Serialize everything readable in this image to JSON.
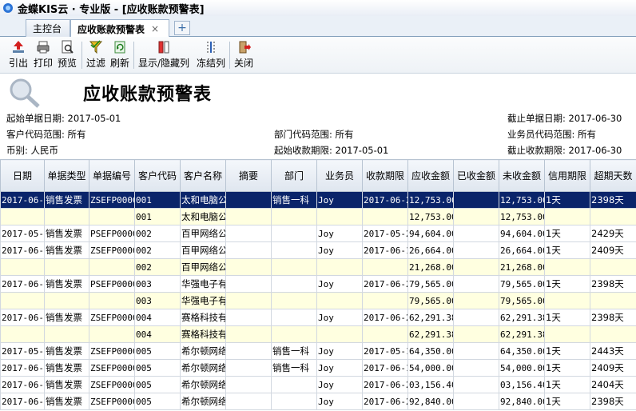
{
  "window": {
    "title": "金蝶KIS云 · 专业版 - [应收账款预警表]"
  },
  "tabs": [
    {
      "label": "主控台"
    },
    {
      "label": "应收账款预警表",
      "close": "×"
    }
  ],
  "tab_add": "+",
  "toolbar": {
    "export": "引出",
    "print": "打印",
    "preview": "预览",
    "filter": "过滤",
    "refresh": "刷新",
    "show_hide": "显示/隐藏列",
    "freeze": "冻结列",
    "close": "关闭"
  },
  "report": {
    "title": "应收账款预警表",
    "start_date": "起始单据日期: 2017-05-01",
    "end_date": "截止单据日期: 2017-06-30",
    "customer_range": "客户代码范围: 所有",
    "dept_range": "部门代码范围: 所有",
    "staff_range": "业务员代码范围: 所有",
    "currency": "币别: 人民币",
    "start_due": "起始收款期限: 2017-05-01",
    "end_due": "截止收款期限: 2017-06-30"
  },
  "columns": [
    "日期",
    "单据类型",
    "单据编号",
    "客户代码",
    "客户名称",
    "摘要",
    "部门",
    "业务员",
    "收款期限",
    "应收金额",
    "已收金额",
    "未收金额",
    "信用期限",
    "超期天数"
  ],
  "rows": [
    {
      "kind": "sel",
      "cells": [
        "2017-06-2",
        "销售发票（",
        "ZSEFP0000",
        "001",
        "太和电脑公",
        "",
        "销售一科",
        "Joy",
        "2017-06-2",
        "12,753.00",
        "",
        "12,753.00",
        "1天",
        "2398天"
      ]
    },
    {
      "kind": "sub",
      "cells": [
        "",
        "",
        "",
        "001",
        "太和电脑公",
        "",
        "",
        "",
        "",
        "12,753.00",
        "",
        "12,753.00",
        "",
        ""
      ]
    },
    {
      "kind": "row",
      "cells": [
        "2017-05-2",
        "销售发票（",
        "PSEFP0000",
        "002",
        "百甲网络公",
        "",
        "",
        "Joy",
        "2017-05-2",
        "94,604.00",
        "",
        "94,604.00",
        "1天",
        "2429天"
      ]
    },
    {
      "kind": "row",
      "cells": [
        "2017-06-1",
        "销售发票（",
        "ZSEFP0000",
        "002",
        "百甲网络公",
        "",
        "",
        "Joy",
        "2017-06-1",
        "26,664.00",
        "",
        "26,664.00",
        "1天",
        "2409天"
      ]
    },
    {
      "kind": "sub",
      "cells": [
        "",
        "",
        "",
        "002",
        "百甲网络公",
        "",
        "",
        "",
        "",
        "21,268.00",
        "",
        "21,268.00",
        "",
        ""
      ]
    },
    {
      "kind": "row",
      "cells": [
        "2017-06-2",
        "销售发票（",
        "PSEFP0000",
        "003",
        "华强电子有",
        "",
        "",
        "Joy",
        "2017-06-2",
        "79,565.00",
        "",
        "79,565.00",
        "1天",
        "2398天"
      ]
    },
    {
      "kind": "sub",
      "cells": [
        "",
        "",
        "",
        "003",
        "华强电子有",
        "",
        "",
        "",
        "",
        "79,565.00",
        "",
        "79,565.00",
        "",
        ""
      ]
    },
    {
      "kind": "row",
      "cells": [
        "2017-06-2",
        "销售发票（",
        "ZSEFP0000",
        "004",
        "赛格科技有",
        "",
        "",
        "Joy",
        "2017-06-2",
        "62,291.38",
        "",
        "62,291.38",
        "1天",
        "2398天"
      ]
    },
    {
      "kind": "sub",
      "cells": [
        "",
        "",
        "",
        "004",
        "赛格科技有",
        "",
        "",
        "",
        "",
        "62,291.38",
        "",
        "62,291.38",
        "",
        ""
      ]
    },
    {
      "kind": "row",
      "cells": [
        "2017-05-1",
        "销售发票（",
        "ZSEFP0000",
        "005",
        "希尔顿网络",
        "",
        "销售一科",
        "Joy",
        "2017-05-1",
        "64,350.00",
        "",
        "64,350.00",
        "1天",
        "2443天"
      ]
    },
    {
      "kind": "row",
      "cells": [
        "2017-06-1",
        "销售发票（",
        "ZSEFP0000",
        "005",
        "希尔顿网络",
        "",
        "销售一科",
        "Joy",
        "2017-06-1",
        "54,000.00",
        "",
        "54,000.00",
        "1天",
        "2409天"
      ]
    },
    {
      "kind": "row",
      "cells": [
        "2017-06-2",
        "销售发票（",
        "ZSEFP0000",
        "005",
        "希尔顿网络",
        "",
        "",
        "Joy",
        "2017-06-2",
        "03,156.40",
        "",
        "03,156.40",
        "1天",
        "2404天"
      ]
    },
    {
      "kind": "row",
      "cells": [
        "2017-06-2",
        "销售发票（",
        "ZSEFP0000",
        "005",
        "希尔顿网络",
        "",
        "",
        "Joy",
        "2017-06-2",
        "92,840.00",
        "",
        "92,840.00",
        "1天",
        "2398天"
      ]
    }
  ]
}
